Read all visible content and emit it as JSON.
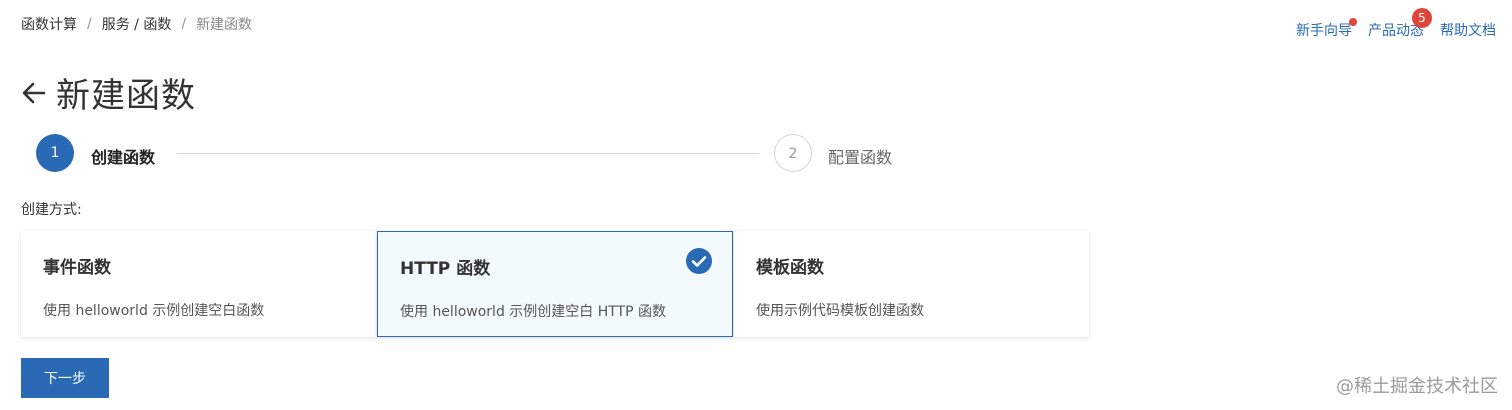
{
  "breadcrumb": {
    "items": [
      "函数计算",
      "服务 / 函数",
      "新建函数"
    ],
    "separator": "/"
  },
  "top_links": {
    "guide": "新手向导",
    "news": "产品动态",
    "news_badge": "5",
    "docs": "帮助文档"
  },
  "page": {
    "title": "新建函数",
    "back_icon": "arrow-left-icon"
  },
  "steps": [
    {
      "number": "1",
      "label": "创建函数",
      "active": true
    },
    {
      "number": "2",
      "label": "配置函数",
      "active": false
    }
  ],
  "creation_method": {
    "label": "创建方式:",
    "cards": [
      {
        "title": "事件函数",
        "desc": "使用 helloworld 示例创建空白函数",
        "selected": false
      },
      {
        "title": "HTTP 函数",
        "desc": "使用 helloworld 示例创建空白 HTTP 函数",
        "selected": true
      },
      {
        "title": "模板函数",
        "desc": "使用示例代码模板创建函数",
        "selected": false
      }
    ]
  },
  "next_button": "下一步",
  "watermark": "@稀土掘金技术社区",
  "colors": {
    "accent": "#2a6ab5",
    "badge": "#e0453a",
    "selected_bg": "#f3fafd"
  }
}
